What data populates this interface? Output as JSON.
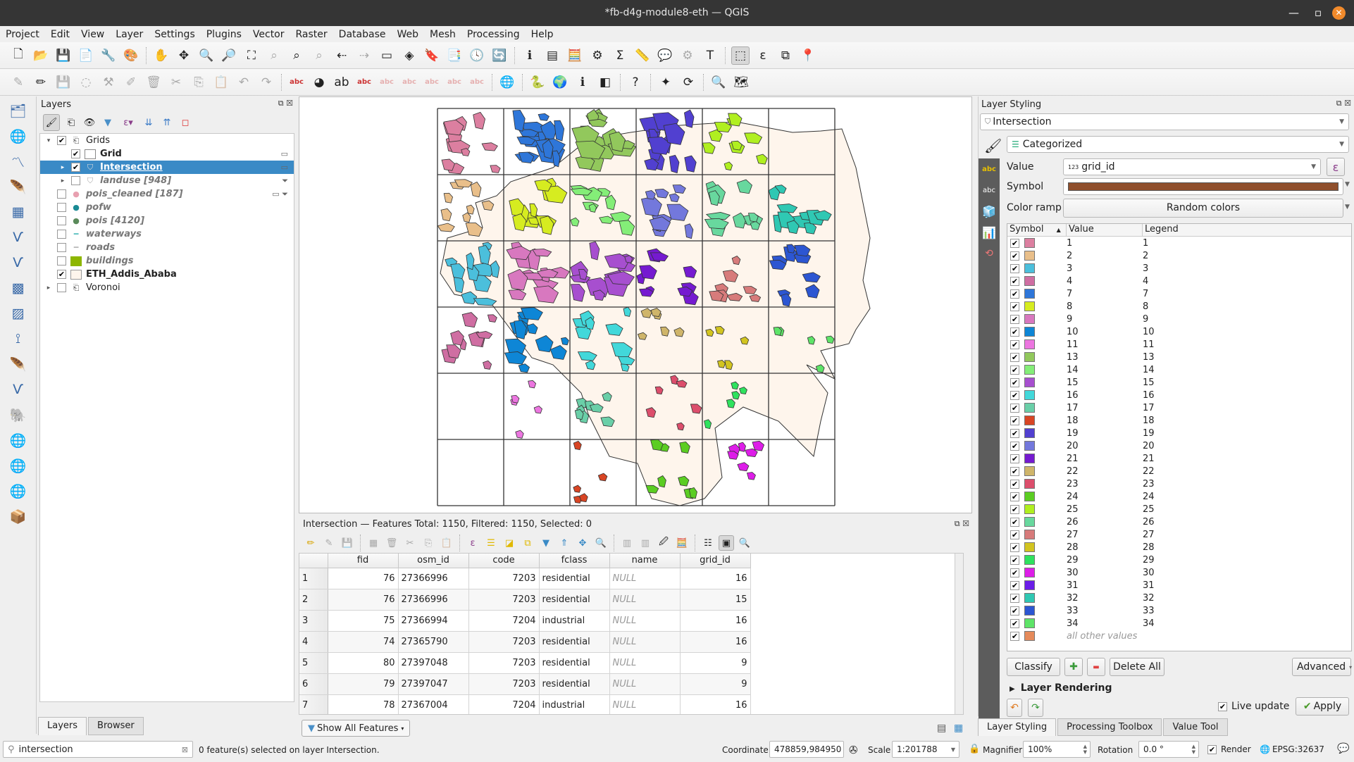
{
  "window": {
    "title": "*fb-d4g-module8-eth — QGIS",
    "minimize": "—",
    "maximize": "▫",
    "close": "✕"
  },
  "menu": [
    "Project",
    "Edit",
    "View",
    "Layer",
    "Settings",
    "Plugins",
    "Vector",
    "Raster",
    "Database",
    "Web",
    "Mesh",
    "Processing",
    "Help"
  ],
  "toolbar1": [
    {
      "name": "new-project-icon",
      "g": "🗋"
    },
    {
      "name": "open-project-icon",
      "g": "📂"
    },
    {
      "name": "save-project-icon",
      "g": "💾"
    },
    {
      "name": "new-print-layout-icon",
      "g": "📄"
    },
    {
      "name": "layout-manager-icon",
      "g": "🔧"
    },
    {
      "name": "style-manager-icon",
      "g": "🎨"
    },
    {
      "sep": true
    },
    {
      "name": "pan-icon",
      "g": "✋"
    },
    {
      "name": "pan-to-selection-icon",
      "g": "✥"
    },
    {
      "name": "zoom-in-icon",
      "g": "🔍"
    },
    {
      "name": "zoom-out-icon",
      "g": "🔎"
    },
    {
      "name": "zoom-full-icon",
      "g": "⛶"
    },
    {
      "name": "zoom-to-selection-icon",
      "g": "⌕",
      "dis": true
    },
    {
      "name": "zoom-to-layer-icon",
      "g": "⌕"
    },
    {
      "name": "zoom-native-icon",
      "g": "⌕",
      "dis": true
    },
    {
      "name": "zoom-last-icon",
      "g": "⇠"
    },
    {
      "name": "zoom-next-icon",
      "g": "⇢",
      "dis": true
    },
    {
      "name": "new-map-view-icon",
      "g": "▭"
    },
    {
      "name": "new-3d-map-icon",
      "g": "◈"
    },
    {
      "name": "new-bookmark-icon",
      "g": "🔖"
    },
    {
      "name": "show-bookmarks-icon",
      "g": "📑"
    },
    {
      "name": "temporal-controller-icon",
      "g": "🕓"
    },
    {
      "name": "refresh-icon",
      "g": "🔄"
    },
    {
      "sep": true
    },
    {
      "name": "identify-icon",
      "g": "ℹ"
    },
    {
      "name": "open-attribute-table-icon",
      "g": "▤"
    },
    {
      "name": "field-calculator-icon",
      "g": "🧮"
    },
    {
      "name": "processing-toolbox-icon",
      "g": "⚙"
    },
    {
      "name": "statistics-icon",
      "g": "Σ"
    },
    {
      "name": "measure-icon",
      "g": "📏"
    },
    {
      "name": "map-tips-icon",
      "g": "💬"
    },
    {
      "name": "actions-icon",
      "g": "⚙",
      "dis": true
    },
    {
      "name": "text-annotation-icon",
      "g": "T"
    },
    {
      "sep": true
    },
    {
      "name": "select-features-icon",
      "g": "⬚",
      "active": true
    },
    {
      "name": "select-by-expression-icon",
      "g": "ε"
    },
    {
      "name": "deselect-icon",
      "g": "⧉"
    },
    {
      "name": "select-by-location-icon",
      "g": "📍"
    }
  ],
  "toolbar2": [
    {
      "name": "current-edits-icon",
      "g": "✎",
      "dis": true
    },
    {
      "name": "toggle-editing-icon",
      "g": "✏"
    },
    {
      "name": "save-edits-icon",
      "g": "💾",
      "dis": true
    },
    {
      "name": "digitize-icon",
      "g": "◌",
      "dis": true
    },
    {
      "name": "vertex-tool-icon",
      "g": "⚒",
      "dis": true
    },
    {
      "name": "modify-attributes-icon",
      "g": "✐",
      "dis": true
    },
    {
      "name": "delete-selected-icon",
      "g": "🗑",
      "dis": true
    },
    {
      "name": "cut-features-icon",
      "g": "✂",
      "dis": true
    },
    {
      "name": "copy-features-icon",
      "g": "⎘",
      "dis": true
    },
    {
      "name": "paste-features-icon",
      "g": "📋",
      "dis": true
    },
    {
      "name": "undo-icon",
      "g": "↶",
      "dis": true
    },
    {
      "name": "redo-icon",
      "g": "↷",
      "dis": true
    },
    {
      "sep": true
    },
    {
      "name": "label-tool-icon",
      "g": "abc"
    },
    {
      "name": "diagram-tool-icon",
      "g": "◕"
    },
    {
      "name": "highlight-pinned-labels-icon",
      "g": "ab"
    },
    {
      "name": "pin-labels-icon",
      "g": "abc"
    },
    {
      "name": "show-hide-labels-icon",
      "g": "abc",
      "dis": true
    },
    {
      "name": "move-label-icon",
      "g": "abc",
      "dis": true
    },
    {
      "name": "rotate-label-icon",
      "g": "abc",
      "dis": true
    },
    {
      "name": "change-label-icon",
      "g": "abc",
      "dis": true
    },
    {
      "name": "label-properties-icon",
      "g": "abc",
      "dis": true
    },
    {
      "sep": true
    },
    {
      "name": "osm-search-icon",
      "g": "🌐"
    },
    {
      "sep": true
    },
    {
      "name": "python-console-icon",
      "g": "🐍"
    },
    {
      "name": "globe-icon",
      "g": "🌍"
    },
    {
      "name": "geo-info-icon",
      "g": "ℹ"
    },
    {
      "name": "map-swipe-icon",
      "g": "◧"
    },
    {
      "sep": true
    },
    {
      "name": "help-icon",
      "g": "?"
    },
    {
      "sep": true
    },
    {
      "name": "georeferencer-icon",
      "g": "✦"
    },
    {
      "name": "table-sync-icon",
      "g": "⟳"
    },
    {
      "sep": true
    },
    {
      "name": "locator-search-icon",
      "g": "🔍"
    },
    {
      "name": "map-edit-icon",
      "g": "🗺"
    }
  ],
  "lefttools": [
    "data-source-manager-icon",
    "new-geopackage-icon",
    "new-shapefile-icon",
    "new-spatialite-icon",
    "new-virtual-layer-icon",
    "new-temp-layer-icon",
    "add-vector-icon",
    "add-raster-icon",
    "add-mesh-icon",
    "add-delimited-text-icon",
    "add-spatialite-icon",
    "add-virtual-layer-icon",
    "add-postgis-icon",
    "add-wms-icon",
    "add-wfs-icon",
    "add-wcs-icon",
    "add-arcgis-icon"
  ],
  "layers_panel": {
    "title": "Layers",
    "items": [
      {
        "label": "Grids",
        "checked": true,
        "expand": "▾",
        "indent": 0,
        "sym": "group",
        "style": "normal"
      },
      {
        "label": "Grid",
        "checked": true,
        "expand": "",
        "indent": 1,
        "sym": "box",
        "style": "bold"
      },
      {
        "label": "Intersection",
        "checked": true,
        "expand": "▸",
        "indent": 1,
        "sym": "poly",
        "style": "bold-u",
        "selected": true
      },
      {
        "label": "landuse [948]",
        "checked": false,
        "expand": "▸",
        "indent": 1,
        "sym": "poly",
        "style": "ital"
      },
      {
        "label": "pois_cleaned [187]",
        "checked": false,
        "expand": "",
        "indent": 0,
        "sym": "dot-pink",
        "style": "ital"
      },
      {
        "label": "pofw",
        "checked": false,
        "expand": "",
        "indent": 0,
        "sym": "dot-teal",
        "style": "ital"
      },
      {
        "label": "pois [4120]",
        "checked": false,
        "expand": "",
        "indent": 0,
        "sym": "dot-green",
        "style": "ital"
      },
      {
        "label": "waterways",
        "checked": false,
        "expand": "",
        "indent": 0,
        "sym": "line-teal",
        "style": "ital"
      },
      {
        "label": "roads",
        "checked": false,
        "expand": "",
        "indent": 0,
        "sym": "line-grey",
        "style": "ital"
      },
      {
        "label": "buildings",
        "checked": false,
        "expand": "",
        "indent": 0,
        "sym": "fill-green",
        "style": "ital"
      },
      {
        "label": "ETH_Addis_Ababa",
        "checked": true,
        "expand": "",
        "indent": 0,
        "sym": "fill-cream",
        "style": "bold"
      },
      {
        "label": "Voronoi",
        "checked": false,
        "expand": "▸",
        "indent": 0,
        "sym": "group",
        "style": "normal"
      }
    ],
    "tabs": [
      "Layers",
      "Browser"
    ]
  },
  "attribute_table": {
    "title": "Intersection — Features Total: 1150, Filtered: 1150, Selected: 0",
    "columns": [
      "fid",
      "osm_id",
      "code",
      "fclass",
      "name",
      "grid_id"
    ],
    "rows": [
      {
        "n": "1",
        "fid": "76",
        "osm_id": "27366996",
        "code": "7203",
        "fclass": "residential",
        "name": "NULL",
        "grid_id": "16"
      },
      {
        "n": "2",
        "fid": "76",
        "osm_id": "27366996",
        "code": "7203",
        "fclass": "residential",
        "name": "NULL",
        "grid_id": "15"
      },
      {
        "n": "3",
        "fid": "75",
        "osm_id": "27366994",
        "code": "7204",
        "fclass": "industrial",
        "name": "NULL",
        "grid_id": "16"
      },
      {
        "n": "4",
        "fid": "74",
        "osm_id": "27365790",
        "code": "7203",
        "fclass": "residential",
        "name": "NULL",
        "grid_id": "16"
      },
      {
        "n": "5",
        "fid": "80",
        "osm_id": "27397048",
        "code": "7203",
        "fclass": "residential",
        "name": "NULL",
        "grid_id": "9"
      },
      {
        "n": "6",
        "fid": "79",
        "osm_id": "27397047",
        "code": "7203",
        "fclass": "residential",
        "name": "NULL",
        "grid_id": "9"
      },
      {
        "n": "7",
        "fid": "78",
        "osm_id": "27367004",
        "code": "7204",
        "fclass": "industrial",
        "name": "NULL",
        "grid_id": "16"
      }
    ],
    "show_all": "Show All Features"
  },
  "styling": {
    "title": "Layer Styling",
    "layer": "Intersection",
    "renderer": "Categorized",
    "value_label": "Value",
    "value": "grid_id",
    "value_type": "123",
    "symbol_label": "Symbol",
    "symbol_color": "#8f4f2c",
    "ramp_label": "Color ramp",
    "ramp": "Random colors",
    "table_headers": [
      "Symbol",
      "Value",
      "Legend"
    ],
    "categories": [
      {
        "v": "1",
        "c": "#dc7fa0"
      },
      {
        "v": "2",
        "c": "#e9bf8a"
      },
      {
        "v": "3",
        "c": "#4bbfdc"
      },
      {
        "v": "4",
        "c": "#cf6ea2"
      },
      {
        "v": "7",
        "c": "#2e76d9"
      },
      {
        "v": "8",
        "c": "#d6ec20"
      },
      {
        "v": "9",
        "c": "#d878bf"
      },
      {
        "v": "10",
        "c": "#0e86d6"
      },
      {
        "v": "11",
        "c": "#ec76e0"
      },
      {
        "v": "13",
        "c": "#92c85c"
      },
      {
        "v": "14",
        "c": "#84ee78"
      },
      {
        "v": "15",
        "c": "#a74fcf"
      },
      {
        "v": "16",
        "c": "#42d8da"
      },
      {
        "v": "17",
        "c": "#6acfa8"
      },
      {
        "v": "18",
        "c": "#d84524"
      },
      {
        "v": "19",
        "c": "#5140d0"
      },
      {
        "v": "20",
        "c": "#7378dc"
      },
      {
        "v": "21",
        "c": "#751ad0"
      },
      {
        "v": "22",
        "c": "#cfb56a"
      },
      {
        "v": "23",
        "c": "#dc4e6c"
      },
      {
        "v": "24",
        "c": "#5bcd22"
      },
      {
        "v": "25",
        "c": "#b0ef20"
      },
      {
        "v": "26",
        "c": "#68d89e"
      },
      {
        "v": "27",
        "c": "#d77b7b"
      },
      {
        "v": "28",
        "c": "#d2c420"
      },
      {
        "v": "29",
        "c": "#2fe25e"
      },
      {
        "v": "30",
        "c": "#dd1de8"
      },
      {
        "v": "31",
        "c": "#6a1de8"
      },
      {
        "v": "32",
        "c": "#2fc8b3"
      },
      {
        "v": "33",
        "c": "#2c56d2"
      },
      {
        "v": "34",
        "c": "#5ee468"
      }
    ],
    "other": {
      "label": "all other values",
      "c": "#e58a5a"
    },
    "buttons": {
      "classify": "Classify",
      "add": "✚",
      "remove": "▬",
      "delete_all": "Delete All",
      "advanced": "Advanced"
    },
    "layer_rendering": "Layer Rendering",
    "live_update": "Live update",
    "apply": "Apply",
    "tabs": [
      "Layer Styling",
      "Processing Toolbox",
      "Value Tool"
    ]
  },
  "statusbar": {
    "search": "intersection",
    "message": "0 feature(s) selected on layer Intersection.",
    "coordinate_label": "Coordinate",
    "coordinate": "478859,984950",
    "scale_label": "Scale",
    "scale": "1:201788",
    "magnifier_label": "Magnifier",
    "magnifier": "100%",
    "rotation_label": "Rotation",
    "rotation": "0.0 °",
    "render_label": "Render",
    "crs": "EPSG:32637"
  },
  "map": {
    "background": "#ffffff",
    "city_fill": "#fef5ec",
    "grid_cols": 6,
    "grid_rows": 6,
    "cell_colors": [
      [
        "1",
        "7",
        "13",
        "19",
        "25",
        null
      ],
      [
        "2",
        "8",
        "14",
        "20",
        "26",
        "32"
      ],
      [
        "3",
        "9",
        "15",
        "21",
        "27",
        "33"
      ],
      [
        "4",
        "10",
        "16",
        "22",
        "28",
        "34"
      ],
      [
        null,
        "11",
        "17",
        "23",
        "29",
        null
      ],
      [
        null,
        null,
        "18",
        "24",
        "30",
        null
      ]
    ]
  }
}
